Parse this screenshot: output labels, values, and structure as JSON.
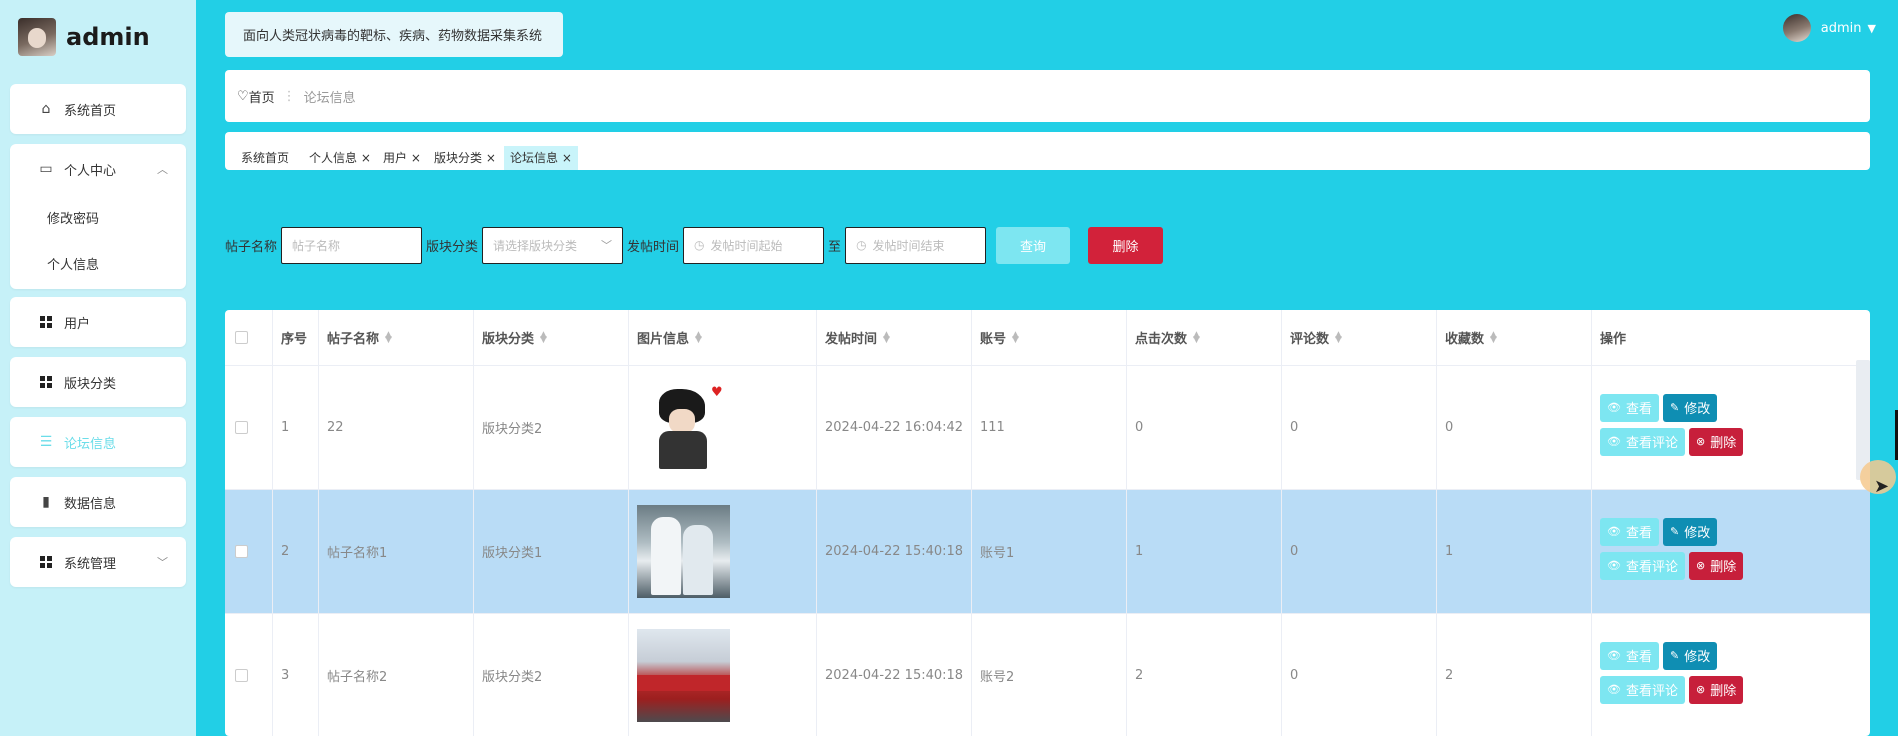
{
  "brand": {
    "name": "admin"
  },
  "system_title": "面向人类冠状病毒的靶标、疾病、药物数据采集系统",
  "user": {
    "name": "admin"
  },
  "sidebar": {
    "home": "系统首页",
    "personal": "个人中心",
    "personal_sub": [
      "修改密码",
      "个人信息"
    ],
    "users": "用户",
    "board_cat": "版块分类",
    "forum": "论坛信息",
    "data_info": "数据信息",
    "sys_manage": "系统管理"
  },
  "breadcrumb": {
    "home": "首页",
    "current": "论坛信息"
  },
  "tags": [
    "系统首页",
    "个人信息 ×",
    "用户 ×",
    "版块分类 ×",
    "论坛信息 ×"
  ],
  "search": {
    "post_name_label": "帖子名称",
    "post_name_placeholder": "帖子名称",
    "board_label": "版块分类",
    "board_placeholder": "请选择版块分类",
    "time_label": "发帖时间",
    "time_start_placeholder": "发帖时间起始",
    "to": "至",
    "time_end_placeholder": "发帖时间结束",
    "query_btn": "查询",
    "delete_btn": "删除"
  },
  "table": {
    "headers": [
      "序号",
      "帖子名称",
      "版块分类",
      "图片信息",
      "发帖时间",
      "账号",
      "点击次数",
      "评论数",
      "收藏数",
      "操作"
    ],
    "rows": [
      {
        "no": "1",
        "name": "22",
        "board": "版块分类2",
        "time": "2024-04-22 16:04:42",
        "account": "111",
        "clicks": "0",
        "comments": "0",
        "favs": "0"
      },
      {
        "no": "2",
        "name": "帖子名称1",
        "board": "版块分类1",
        "time": "2024-04-22 15:40:18",
        "account": "账号1",
        "clicks": "1",
        "comments": "0",
        "favs": "1"
      },
      {
        "no": "3",
        "name": "帖子名称2",
        "board": "版块分类2",
        "time": "2024-04-22 15:40:18",
        "account": "账号2",
        "clicks": "2",
        "comments": "0",
        "favs": "2"
      }
    ],
    "ops": {
      "view": "查看",
      "edit": "修改",
      "comments": "查看评论",
      "delete": "删除"
    }
  },
  "colors": {
    "bg": "#22cfe6",
    "sidebar": "#c6f1f8",
    "danger": "#d2223a",
    "primary_dark": "#0f8eb3",
    "primary_light": "#7de6f1",
    "row_highlight": "#b9dcf6"
  }
}
